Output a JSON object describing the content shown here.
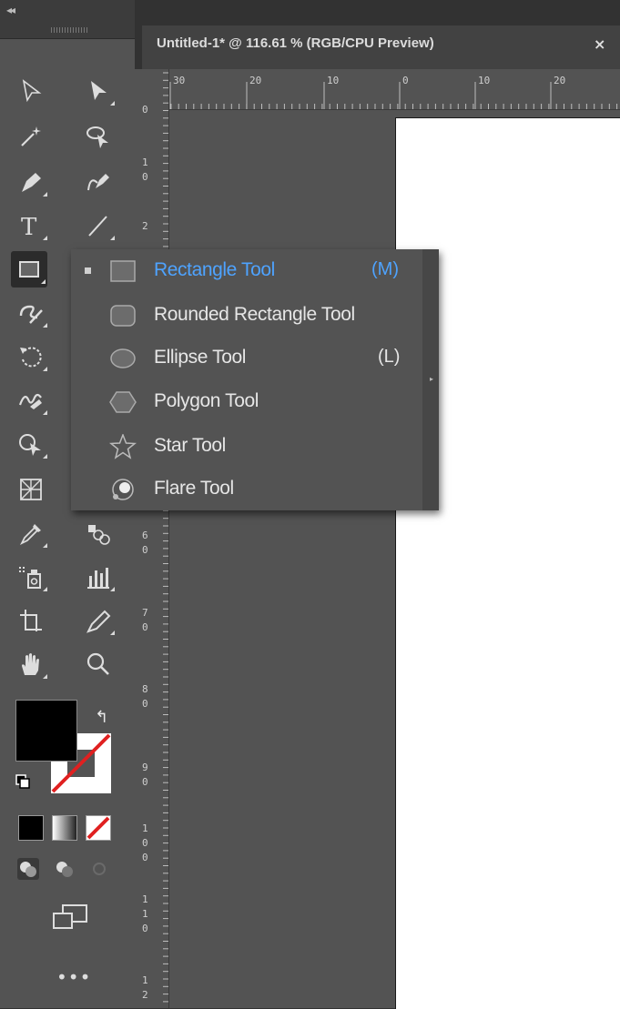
{
  "document": {
    "title": "Untitled-1* @ 116.61 % (RGB/CPU Preview)",
    "close": "×"
  },
  "toolbar": {
    "collapse": "◂◂",
    "more": "•••"
  },
  "ruler_top": [
    "30",
    "20",
    "10",
    "0",
    "10",
    "20"
  ],
  "ruler_left": [
    [
      "0"
    ],
    [
      "1",
      "0"
    ],
    [
      "2"
    ],
    [
      "6",
      "0"
    ],
    [
      "7",
      "0"
    ],
    [
      "8",
      "0"
    ],
    [
      "9",
      "0"
    ],
    [
      "1",
      "0",
      "0"
    ],
    [
      "1",
      "1",
      "0"
    ],
    [
      "1",
      "2"
    ]
  ],
  "flyout": {
    "items": [
      {
        "label": "Rectangle Tool",
        "shortcut": "(M)",
        "icon": "rectangle-icon",
        "selected": true
      },
      {
        "label": "Rounded Rectangle Tool",
        "shortcut": "",
        "icon": "rounded-rectangle-icon"
      },
      {
        "label": "Ellipse Tool",
        "shortcut": "(L)",
        "icon": "ellipse-icon"
      },
      {
        "label": "Polygon Tool",
        "shortcut": "",
        "icon": "polygon-icon"
      },
      {
        "label": "Star Tool",
        "shortcut": "",
        "icon": "star-icon"
      },
      {
        "label": "Flare Tool",
        "shortcut": "",
        "icon": "flare-icon"
      }
    ]
  },
  "colors": {
    "fill": "#000000",
    "stroke": "none",
    "selected_item_text": "#4ea3ff",
    "none_slash": "#e02020"
  }
}
